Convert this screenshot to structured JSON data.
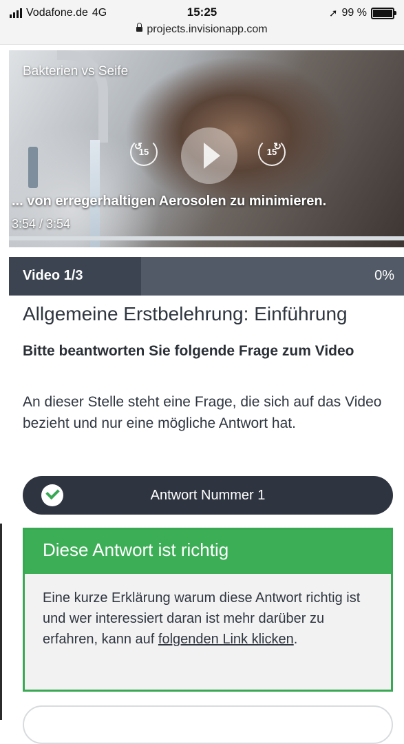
{
  "status_bar": {
    "carrier": "Vodafone.de",
    "network": "4G",
    "time": "15:25",
    "battery": "99 %",
    "url": "projects.invisionapp.com",
    "location_icon": "location-arrow-icon"
  },
  "video": {
    "title": "Bakterien vs Seife",
    "caption": "... von erregerhaltigen Aerosolen zu minimieren.",
    "time": "3:54 / 3:54",
    "skip_back_label": "15",
    "skip_forward_label": "15",
    "playback_progress": 1.0
  },
  "progress_header": {
    "label": "Video 1/3",
    "percent": "0%"
  },
  "content": {
    "title": "Allgemeine Erstbelehrung: Einführung",
    "question_heading": "Bitte beantworten Sie folgende Frage zum Video",
    "question_text": "An dieser Stelle steht eine Frage, die sich auf das Video bezieht und nur eine mögliche Antwort hat."
  },
  "answer": {
    "label": "Antwort Nummer 1",
    "state": "correct"
  },
  "result": {
    "title": "Diese Antwort ist richtig",
    "body_text": "Eine kurze Erklärung warum diese Antwort richtig ist und wer interessiert daran ist mehr darüber zu erfahren, kann auf",
    "link_text": "folgenden Link klicken",
    "trailing": "."
  },
  "colors": {
    "header_dark": "#3b4450",
    "header_light": "#515a66",
    "answer_bg": "#2e3541",
    "success": "#3cae56",
    "result_bg": "#f2f2f2"
  }
}
